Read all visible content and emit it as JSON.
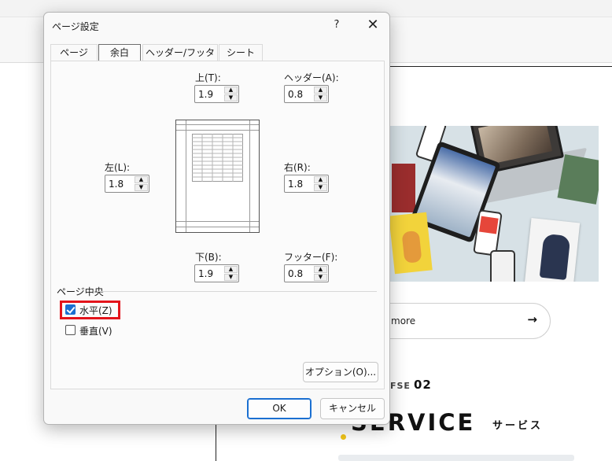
{
  "dialog": {
    "title": "ページ設定",
    "help_label": "?",
    "close_label": "✕",
    "tabs": [
      {
        "label": "ページ",
        "active": false
      },
      {
        "label": "余白",
        "active": true
      },
      {
        "label": "ヘッダー/フッター",
        "active": false
      },
      {
        "label": "シート",
        "active": false
      }
    ],
    "margins": {
      "top": {
        "label": "上(T):",
        "value": "1.9"
      },
      "header": {
        "label": "ヘッダー(A):",
        "value": "0.8"
      },
      "left": {
        "label": "左(L):",
        "value": "1.8"
      },
      "right": {
        "label": "右(R):",
        "value": "1.8"
      },
      "bottom": {
        "label": "下(B):",
        "value": "1.9"
      },
      "footer": {
        "label": "フッター(F):",
        "value": "0.8"
      }
    },
    "center_section": {
      "label": "ページ中央",
      "horizontal": {
        "label": "水平(Z)",
        "checked": true
      },
      "vertical": {
        "label": "垂直(V)",
        "checked": false
      }
    },
    "options_label": "オプション(O)...",
    "ok_label": "OK",
    "cancel_label": "キャンセル"
  },
  "background": {
    "more_text": "more",
    "more_arrow": "→",
    "service_prefix": "FSE",
    "service_number": "02",
    "service_title": "SERVICE",
    "service_subtitle": "サービス"
  },
  "colors": {
    "accent": "#1a6fd1",
    "highlight": "#e3141b",
    "hero_bg": "#d7e1e6"
  }
}
